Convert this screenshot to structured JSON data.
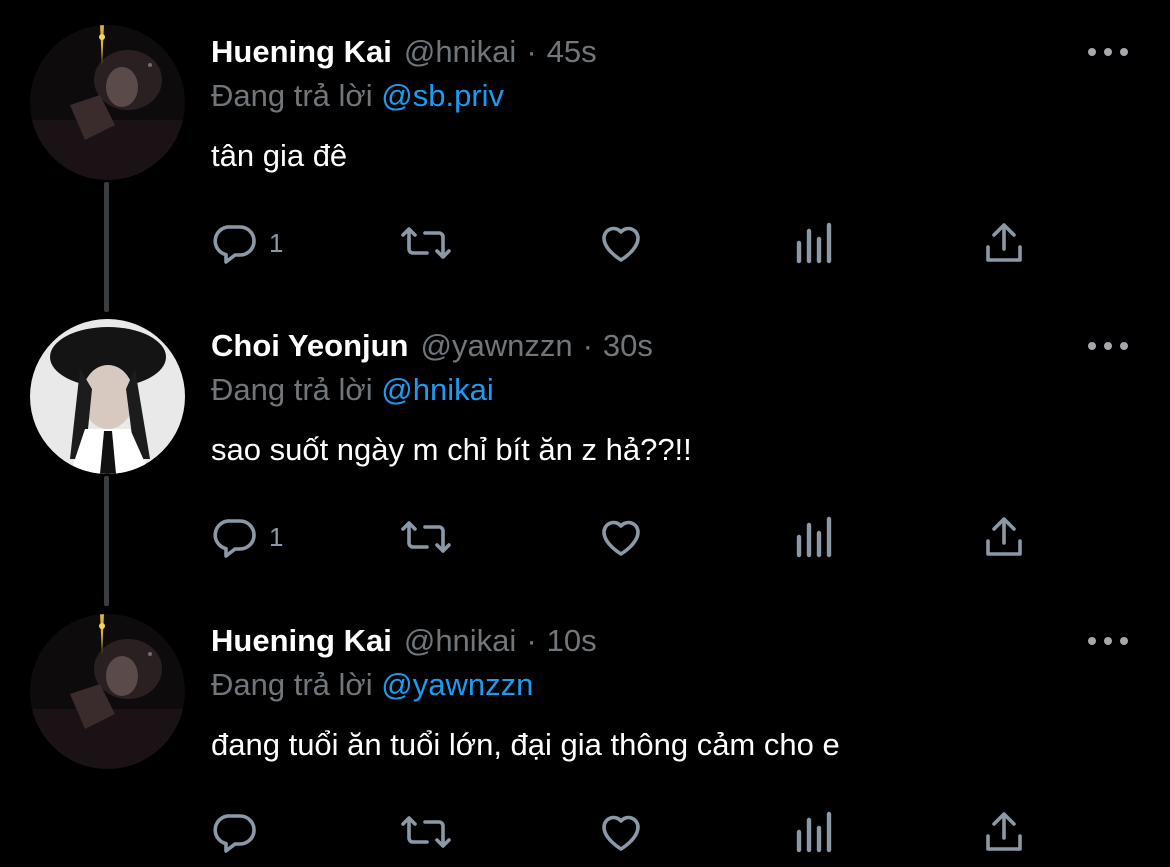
{
  "colors": {
    "background": "#000000",
    "name": "#ffffff",
    "muted": "#71767b",
    "mention": "#1d9bf0",
    "thread_line": "#3a3d41"
  },
  "tweets": [
    {
      "name": "Huening Kai",
      "handle": "@hnikai",
      "separator": "·",
      "time": "45s",
      "reply_prefix": "Đang trả lời",
      "reply_to": "@sb.priv",
      "text": "tân gia đê",
      "reply_count": "1",
      "avatar": "dark-profile-photo-with-light-tower"
    },
    {
      "name": "Choi Yeonjun",
      "handle": "@yawnzzn",
      "separator": "·",
      "time": "30s",
      "reply_prefix": "Đang trả lời",
      "reply_to": "@hnikai",
      "text": "sao suốt ngày m chỉ bít ăn z hả??!!",
      "reply_count": "1",
      "avatar": "profile-photo-black-hat-white-shirt"
    },
    {
      "name": "Huening Kai",
      "handle": "@hnikai",
      "separator": "·",
      "time": "10s",
      "reply_prefix": "Đang trả lời",
      "reply_to": "@yawnzzn",
      "text": "đang tuổi ăn tuổi lớn, đại gia thông cảm cho e",
      "reply_count": "",
      "avatar": "dark-profile-photo-with-light-tower"
    }
  ],
  "icons": {
    "reply": "reply-icon",
    "retweet": "retweet-icon",
    "like": "heart-icon",
    "views": "views-icon",
    "share": "share-icon",
    "more": "more-icon"
  }
}
